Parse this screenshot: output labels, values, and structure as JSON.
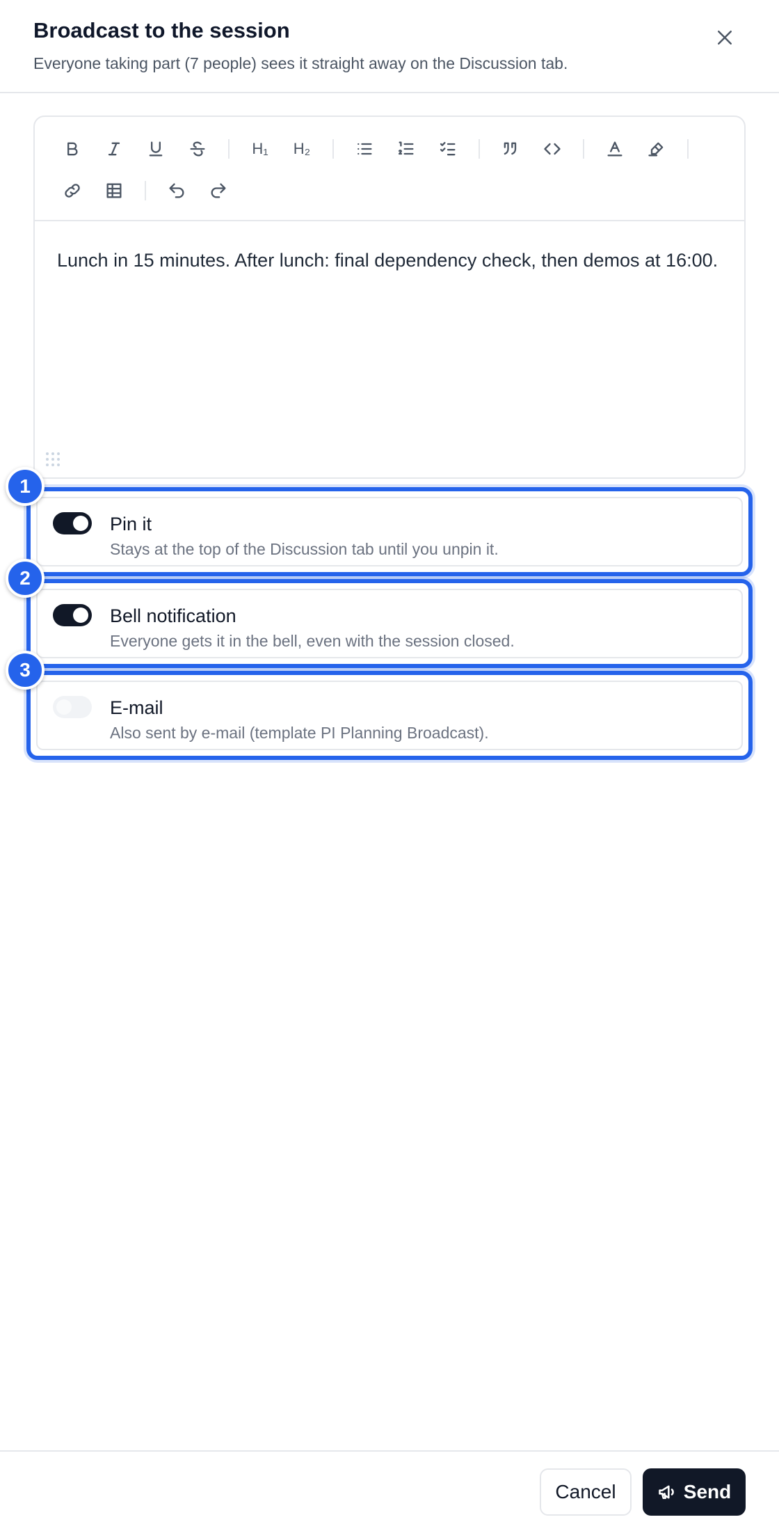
{
  "header": {
    "title": "Broadcast to the session",
    "subtitle": "Everyone taking part (7 people) sees it straight away on the Discussion tab.",
    "close_icon": "close-icon"
  },
  "editor": {
    "toolbar": {
      "buttons": [
        {
          "name": "bold",
          "icon": "bold-icon"
        },
        {
          "name": "italic",
          "icon": "italic-icon"
        },
        {
          "name": "underline",
          "icon": "underline-icon"
        },
        {
          "name": "strikethrough",
          "icon": "strikethrough-icon"
        },
        {
          "name": "heading-1",
          "icon": "heading-1-icon",
          "text": "H₁"
        },
        {
          "name": "heading-2",
          "icon": "heading-2-icon",
          "text": "H₂"
        },
        {
          "name": "bullet-list",
          "icon": "bullet-list-icon"
        },
        {
          "name": "ordered-list",
          "icon": "ordered-list-icon"
        },
        {
          "name": "task-list",
          "icon": "task-list-icon"
        },
        {
          "name": "blockquote",
          "icon": "quote-icon"
        },
        {
          "name": "code",
          "icon": "code-icon"
        },
        {
          "name": "text-color",
          "icon": "text-color-icon"
        },
        {
          "name": "highlight",
          "icon": "highlighter-icon"
        },
        {
          "name": "link",
          "icon": "link-icon"
        },
        {
          "name": "table",
          "icon": "table-icon"
        },
        {
          "name": "undo",
          "icon": "undo-icon"
        },
        {
          "name": "redo",
          "icon": "redo-icon"
        }
      ]
    },
    "content": "Lunch in 15 minutes. After lunch: final dependency check, then demos at 16:00."
  },
  "options": [
    {
      "badge": "1",
      "label": "Pin it",
      "description": "Stays at the top of the Discussion tab until you unpin it.",
      "enabled": true
    },
    {
      "badge": "2",
      "label": "Bell notification",
      "description": "Everyone gets it in the bell, even with the session closed.",
      "enabled": true
    },
    {
      "badge": "3",
      "label": "E-mail",
      "description": "Also sent by e-mail (template PI Planning Broadcast).",
      "enabled": false
    }
  ],
  "footer": {
    "cancel_label": "Cancel",
    "send_label": "Send",
    "send_icon": "megaphone-icon"
  },
  "colors": {
    "accent": "#2563eb",
    "primary_button": "#111827",
    "border": "#e5e7eb"
  }
}
